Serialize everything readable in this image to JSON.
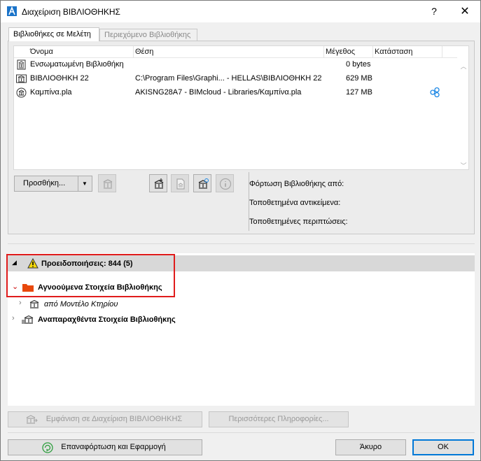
{
  "window": {
    "title": "Διαχείριση ΒΙΒΛΙΟΘΗΚΗΣ",
    "help_glyph": "?",
    "close_glyph": "✕"
  },
  "tabs": [
    {
      "label": "Βιβλιοθήκες σε Μελέτη",
      "active": true
    },
    {
      "label": "Περιεχόμενο Βιβλιοθήκης",
      "active": false
    }
  ],
  "libraries": {
    "columns": [
      "Όνομα",
      "Θέση",
      "Μέγεθος",
      "Κατάσταση"
    ],
    "rows": [
      {
        "icon": "embedded-library-icon",
        "name": "Ενσωματωμένη Βιβλιοθήκη",
        "location": "",
        "size": "0 bytes",
        "status": ""
      },
      {
        "icon": "local-library-icon",
        "name": "ΒΙΒΛΙΟΘΗΚΗ 22",
        "location": "C:\\Program Files\\Graphi... - HELLAS\\ΒΙΒΛΙΟΘΗΚΗ 22",
        "size": "629 MB",
        "status": ""
      },
      {
        "icon": "bimcloud-library-icon",
        "name": "Καμπίνα.pla",
        "location": "AKISNG28A7 - BIMcloud - Libraries/Καμπίνα.pla",
        "size": "127 MB",
        "status": "bimcloud-status-icon"
      }
    ]
  },
  "toolbar": {
    "add_label": "Προσθήκη...",
    "dropdown_glyph": "▼"
  },
  "info": {
    "loaded_from": "Φόρτωση Βιβλιοθήκης από:",
    "placed_objects": "Τοποθετημένα αντικείμενα:",
    "placed_instances": "Τοποθετημένες περιπτώσεις:"
  },
  "warnings": {
    "header": "Προειδοποιήσεις: 844 (5)",
    "group": "Αγνοούμενα Στοιχεία Βιβλιοθήκης",
    "group_child": "από Μοντέλο Κτηρίου",
    "second_group": "Αναπαραχθέντα Στοιχεία Βιβλιοθήκης"
  },
  "actions": {
    "show_in_manager": "Εμφάνιση σε Διαχείριση ΒΙΒΛΙΟΘΗΚΗΣ",
    "more_info": "Περισσότερες Πληροφορίες...",
    "reload_apply": "Επαναφόρτωση και Εφαρμογή",
    "cancel": "Άκυρο",
    "ok": "OK"
  },
  "colors": {
    "highlight_border": "#e01c1c",
    "folder": "#e8480c",
    "warning_yellow": "#f5d90a",
    "bimcloud_blue": "#1e88e5",
    "reload_green": "#2e9e3e",
    "ok_border": "#0078d7"
  }
}
